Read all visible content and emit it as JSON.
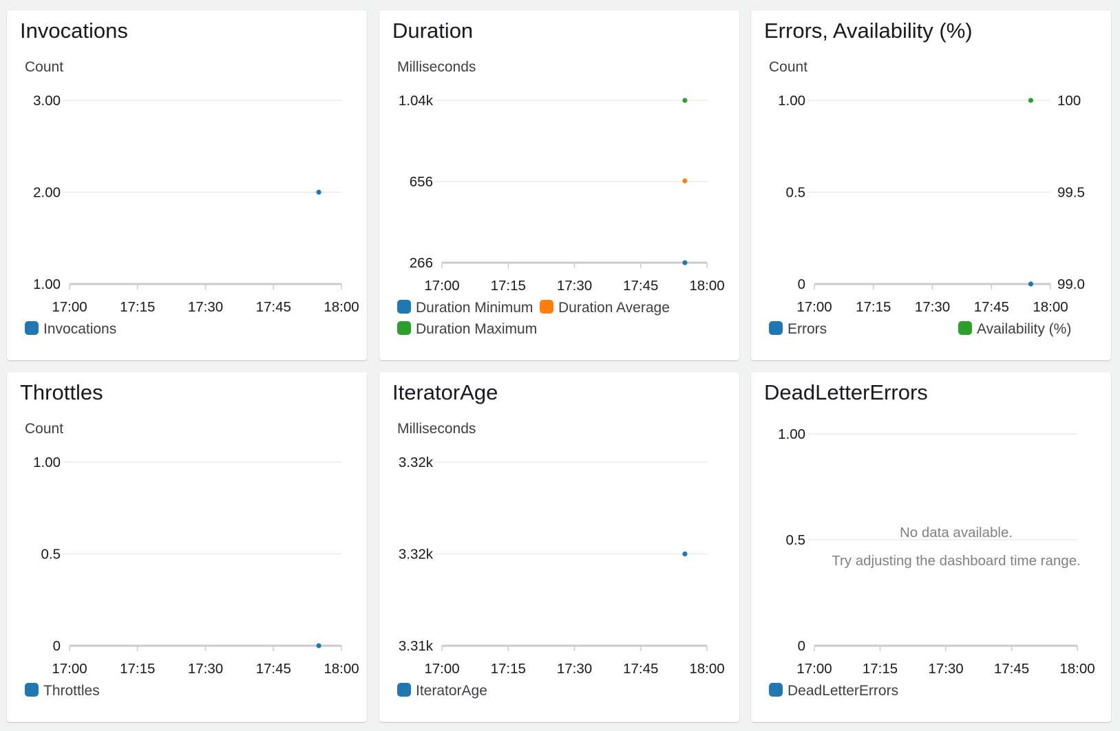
{
  "colors": {
    "blue": "#1f77b4",
    "orange": "#ff7f0e",
    "green": "#2ca02c"
  },
  "widgets": [
    {
      "id": "invocations",
      "title": "Invocations",
      "left_unit": "Count",
      "left_ticks": [
        "3.00",
        "2.00",
        "1.00"
      ],
      "x_ticks": [
        "17:00",
        "17:15",
        "17:30",
        "17:45",
        "18:00"
      ],
      "legend": [
        {
          "label": "Invocations",
          "color": "#1f77b4"
        }
      ]
    },
    {
      "id": "duration",
      "title": "Duration",
      "left_unit": "Milliseconds",
      "left_ticks": [
        "1.04k",
        "656",
        "266"
      ],
      "x_ticks": [
        "17:00",
        "17:15",
        "17:30",
        "17:45",
        "18:00"
      ],
      "legend": [
        {
          "label": "Duration Minimum",
          "color": "#1f77b4"
        },
        {
          "label": "Duration Average",
          "color": "#ff7f0e"
        },
        {
          "label": "Duration Maximum",
          "color": "#2ca02c"
        }
      ]
    },
    {
      "id": "errors-availability",
      "title": "Errors, Availability (%)",
      "left_unit": "Count",
      "left_ticks": [
        "1.00",
        "0.5",
        "0"
      ],
      "right_ticks": [
        "100",
        "99.5",
        "99.0"
      ],
      "x_ticks": [
        "17:00",
        "17:15",
        "17:30",
        "17:45",
        "18:00"
      ],
      "legend": [
        {
          "label": "Errors",
          "color": "#1f77b4"
        },
        {
          "label": "Availability (%)",
          "color": "#2ca02c"
        }
      ]
    },
    {
      "id": "throttles",
      "title": "Throttles",
      "left_unit": "Count",
      "left_ticks": [
        "1.00",
        "0.5",
        "0"
      ],
      "x_ticks": [
        "17:00",
        "17:15",
        "17:30",
        "17:45",
        "18:00"
      ],
      "legend": [
        {
          "label": "Throttles",
          "color": "#1f77b4"
        }
      ]
    },
    {
      "id": "iterator-age",
      "title": "IteratorAge",
      "left_unit": "Milliseconds",
      "left_ticks": [
        "3.32k",
        "3.32k",
        "3.31k"
      ],
      "x_ticks": [
        "17:00",
        "17:15",
        "17:30",
        "17:45",
        "18:00"
      ],
      "legend": [
        {
          "label": "IteratorAge",
          "color": "#1f77b4"
        }
      ]
    },
    {
      "id": "dead-letter-errors",
      "title": "DeadLetterErrors",
      "left_unit": "",
      "left_ticks": [
        "1.00",
        "0.5",
        "0"
      ],
      "x_ticks": [
        "17:00",
        "17:15",
        "17:30",
        "17:45",
        "18:00"
      ],
      "no_data": [
        "No data available.",
        "Try adjusting the dashboard time range."
      ],
      "legend": [
        {
          "label": "DeadLetterErrors",
          "color": "#1f77b4"
        }
      ]
    }
  ],
  "chart_data": [
    {
      "type": "scatter",
      "title": "Invocations",
      "ylabel": "Count",
      "x_range": [
        "17:00",
        "18:00"
      ],
      "ylim": [
        1,
        3
      ],
      "series": [
        {
          "name": "Invocations",
          "color": "#1f77b4",
          "x": [
            "17:55"
          ],
          "y": [
            2
          ]
        }
      ]
    },
    {
      "type": "scatter",
      "title": "Duration",
      "ylabel": "Milliseconds",
      "x_range": [
        "17:00",
        "18:00"
      ],
      "ylim": [
        266,
        1040
      ],
      "series": [
        {
          "name": "Duration Minimum",
          "color": "#1f77b4",
          "x": [
            "17:55"
          ],
          "y": [
            266
          ]
        },
        {
          "name": "Duration Average",
          "color": "#ff7f0e",
          "x": [
            "17:55"
          ],
          "y": [
            656
          ]
        },
        {
          "name": "Duration Maximum",
          "color": "#2ca02c",
          "x": [
            "17:55"
          ],
          "y": [
            1040
          ]
        }
      ]
    },
    {
      "type": "scatter",
      "title": "Errors, Availability (%)",
      "ylabel": "Count",
      "x_range": [
        "17:00",
        "18:00"
      ],
      "ylim": [
        0,
        1
      ],
      "ylim_right": [
        99.0,
        100
      ],
      "series": [
        {
          "name": "Errors",
          "color": "#1f77b4",
          "axis": "left",
          "x": [
            "17:55"
          ],
          "y": [
            0
          ]
        },
        {
          "name": "Availability (%)",
          "color": "#2ca02c",
          "axis": "right",
          "x": [
            "17:55"
          ],
          "y": [
            100
          ]
        }
      ]
    },
    {
      "type": "scatter",
      "title": "Throttles",
      "ylabel": "Count",
      "x_range": [
        "17:00",
        "18:00"
      ],
      "ylim": [
        0,
        1
      ],
      "series": [
        {
          "name": "Throttles",
          "color": "#1f77b4",
          "x": [
            "17:55"
          ],
          "y": [
            0
          ]
        }
      ]
    },
    {
      "type": "scatter",
      "title": "IteratorAge",
      "ylabel": "Milliseconds",
      "x_range": [
        "17:00",
        "18:00"
      ],
      "ylim": [
        3310,
        3330
      ],
      "series": [
        {
          "name": "IteratorAge",
          "color": "#1f77b4",
          "x": [
            "17:55"
          ],
          "y": [
            3320
          ]
        }
      ]
    },
    {
      "type": "scatter",
      "title": "DeadLetterErrors",
      "x_range": [
        "17:00",
        "18:00"
      ],
      "ylim": [
        0,
        1
      ],
      "series": []
    }
  ]
}
